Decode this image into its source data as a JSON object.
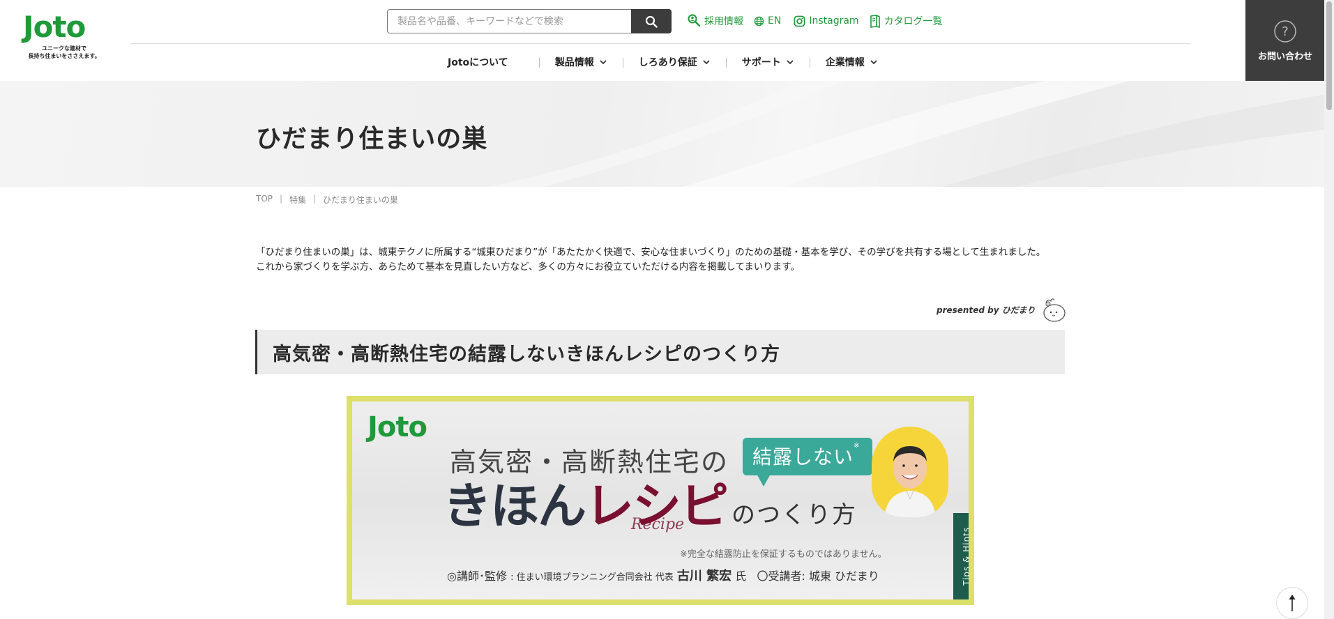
{
  "brand": {
    "logo_text": "Joto",
    "tagline_1": "ユニークな建材で",
    "tagline_2": "長持ち住まいをささえます。",
    "color": "#1f9a3a"
  },
  "search": {
    "placeholder": "製品名や品番、キーワードなどで検索",
    "value": ""
  },
  "util_links": [
    {
      "label": "採用情報",
      "icon": "recruit-search-icon"
    },
    {
      "label": "EN",
      "icon": "globe-icon"
    },
    {
      "label": "Instagram",
      "icon": "instagram-icon"
    },
    {
      "label": "カタログ一覧",
      "icon": "catalog-icon"
    }
  ],
  "gnav": [
    {
      "label": "Jotoについて"
    },
    {
      "label": "製品情報"
    },
    {
      "label": "しろあり保証"
    },
    {
      "label": "サポート"
    },
    {
      "label": "企業情報"
    }
  ],
  "contact": {
    "label": "お問い合わせ",
    "icon": "question-circle-icon"
  },
  "hero": {
    "title": "ひだまり住まいの巣"
  },
  "breadcrumb": {
    "items": [
      "TOP",
      "特集",
      "ひだまり住まいの巣"
    ]
  },
  "intro": {
    "line1": "「ひだまり住まいの巣」は、城東テクノに所属する“城東ひだまり”が「あたたかく快適で、安心な住まいづくり」のための基礎・基本を学び、その学びを共有する場として生まれました。",
    "line2": "これから家づくりを学ぶ方、あらためて基本を見直したい方など、多くの方々にお役立ていただける内容を掲載してまいります。"
  },
  "presented": {
    "label": "presented by ひだまり"
  },
  "section": {
    "title": "高気密・高断熱住宅の結露しないきほんレシピのつくり方"
  },
  "banner": {
    "logo": "Joto",
    "line1": "高気密・高断熱住宅の",
    "bubble": "結露しない",
    "bubble_mark": "※",
    "line2_dark": "きほん",
    "line2_red": "レシピ",
    "line2_rest": "のつくり方",
    "recipe_script": "Recipe",
    "note": "※完全な結露防止を保証するものではありません。",
    "credit_prefix": "◎講師･監修",
    "credit_org": ": 住まい環境プランニング合同会社 代表",
    "credit_name": "古川 繁宏",
    "credit_suffix": "氏",
    "credit_student": "〇受講者: 城東 ひだまり",
    "tab": "Tips & Hints"
  }
}
